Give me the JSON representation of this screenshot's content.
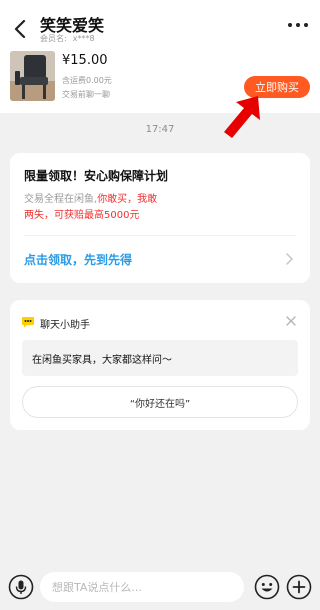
{
  "header": {
    "title": "笑笑爱笑",
    "member_label": "会员名:",
    "member_value": "x***8",
    "more_icon": "more-dots-icon",
    "back_icon": "back-arrow-icon"
  },
  "item": {
    "price": "¥15.00",
    "shipping": "含运费0.00元",
    "chat_hint": "交易前聊一聊",
    "buy_label": "立即购买",
    "buy_color": "#ff5a22"
  },
  "chat": {
    "timestamp": "17:47"
  },
  "guarantee_card": {
    "title": "限量领取！安心购保障计划",
    "line1_gray": "交易全程在闲鱼,",
    "line1_red": "你敢买，我敢",
    "line2_red": "两失，可获赔最高5000元",
    "claim_label": "点击领取，先到先得",
    "claim_color": "#2a9be6"
  },
  "assistant_card": {
    "title": "聊天小助手",
    "question": "在闲鱼买家具，大家都这样问～",
    "quick_reply": "“你好还在吗”"
  },
  "input_bar": {
    "placeholder": "想跟TA说点什么...",
    "voice_icon": "microphone-icon",
    "emoji_icon": "emoji-icon",
    "plus_icon": "plus-icon"
  }
}
